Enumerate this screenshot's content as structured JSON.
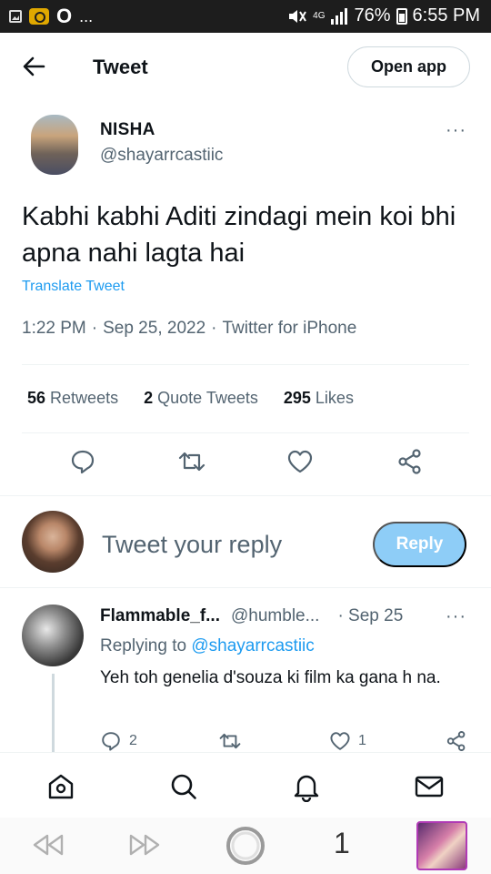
{
  "status_bar": {
    "network": "4G",
    "battery": "76%",
    "time": "6:55 PM",
    "left_text": "O",
    "overflow": "..."
  },
  "header": {
    "title": "Tweet",
    "open_app_label": "Open app"
  },
  "tweet": {
    "author_name": "NISHA",
    "author_handle": "@shayarrcastiic",
    "text": "Kabhi kabhi Aditi zindagi mein koi bhi apna nahi lagta hai",
    "translate_label": "Translate Tweet",
    "time": "1:22 PM",
    "date": "Sep 25, 2022",
    "source": "Twitter for iPhone",
    "separator": "·",
    "more": "···",
    "stats": {
      "retweets_count": "56",
      "retweets_label": "Retweets",
      "quotes_count": "2",
      "quotes_label": "Quote Tweets",
      "likes_count": "295",
      "likes_label": "Likes"
    }
  },
  "composer": {
    "placeholder": "Tweet your reply",
    "reply_label": "Reply"
  },
  "reply": {
    "name": "Flammable_f...",
    "handle": "@humble...",
    "date": "· Sep 25",
    "more": "···",
    "replying_prefix": "Replying to",
    "replying_to": "@shayarrcastiic",
    "text": "Yeh toh genelia d'souza ki film ka gana h na.",
    "reply_count": "2",
    "like_count": "1"
  },
  "browser": {
    "tabs_count": "1"
  },
  "colors": {
    "accent": "#1d9bf0",
    "reply_button": "#8ecdf7",
    "muted_text": "#536471",
    "divider": "#eff3f4"
  }
}
